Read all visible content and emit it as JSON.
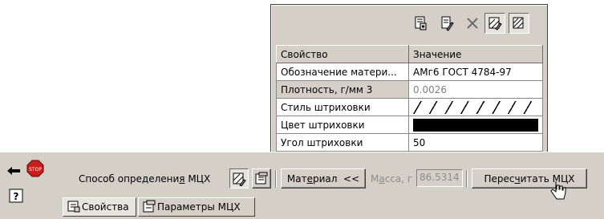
{
  "property_panel": {
    "toolbar_icons": [
      "material-library-icon",
      "material-edit-icon",
      "delete-icon",
      "hatch-params-icon",
      "hatch-edit-icon"
    ],
    "columns": {
      "property": "Свойство",
      "value": "Значение"
    },
    "rows": [
      {
        "property": "Обозначение матери...",
        "value": "АМг6  ГОСТ 4784-97"
      },
      {
        "property": "Плотность, г/мм 3",
        "value": "0.0026"
      },
      {
        "property": "Стиль штриховки",
        "value": ""
      },
      {
        "property": "Цвет штриховки",
        "value": ""
      },
      {
        "property": "Угол штриховки",
        "value": "50"
      }
    ],
    "hatch_color": "#000000"
  },
  "bottom_bar": {
    "method_label_pre": "Способ определени",
    "method_label_ul": "я",
    "method_label_post": " МЦХ",
    "material_btn_pre": "Мат",
    "material_btn_ul": "е",
    "material_btn_post": "риал  <<",
    "mass_label_pre": "М",
    "mass_label_ul": "а",
    "mass_label_post": "сса, г",
    "mass_value": "86.5314",
    "recalc_btn_pre": "Перес",
    "recalc_btn_ul": "ч",
    "recalc_btn_post": "итать МЦХ",
    "tabs": [
      {
        "label": "Свойства",
        "active": true
      },
      {
        "label": "Параметры МЦХ",
        "active": false
      }
    ]
  },
  "colors": {
    "panel": "#d4d0c8",
    "stop_red": "#c81e1e"
  }
}
